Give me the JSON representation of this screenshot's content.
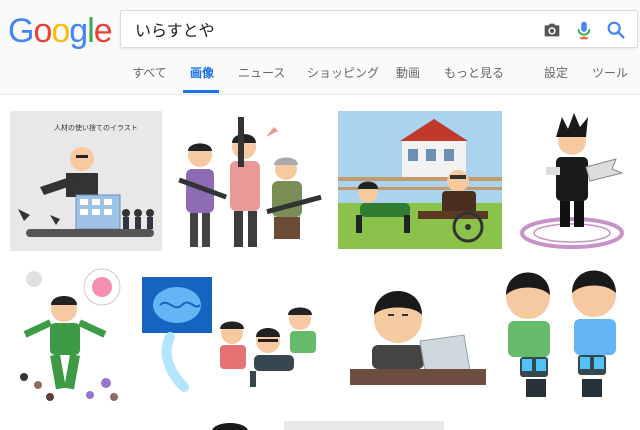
{
  "logo": {
    "letters": [
      "G",
      "o",
      "o",
      "g",
      "l",
      "e"
    ],
    "colors": [
      "#4285F4",
      "#EA4335",
      "#FBBC05",
      "#4285F4",
      "#34A853",
      "#EA4335"
    ]
  },
  "search": {
    "value": "いらすとや"
  },
  "tabs": [
    {
      "label": "すべて",
      "active": false
    },
    {
      "label": "画像",
      "active": true
    },
    {
      "label": "ニュース",
      "active": false
    },
    {
      "label": "ショッピング",
      "active": false
    },
    {
      "label": "動画",
      "active": false
    },
    {
      "label": "もっと見る",
      "active": false
    },
    {
      "label": "設定",
      "active": false
    },
    {
      "label": "ツール",
      "active": false
    }
  ],
  "results": {
    "first_image_caption": "人材の使い捨てのイラスト"
  },
  "colors": {
    "accent": "#1a73e8",
    "header_bg": "#fafafa"
  }
}
